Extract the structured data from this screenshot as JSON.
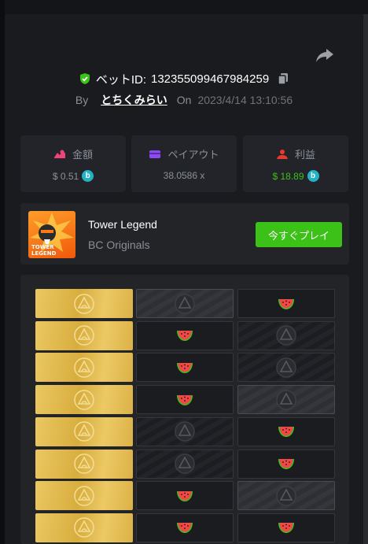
{
  "bet": {
    "id_label": "ベットID:",
    "id": "132355099467984259"
  },
  "meta": {
    "by": "By",
    "user": "とちくみらい",
    "on": "On",
    "date": "2023/4/14 13:10:56"
  },
  "stats": {
    "amount": {
      "label": "金額",
      "value": "$ 0.51",
      "icon": "money-icon"
    },
    "payout": {
      "label": "ペイアウト",
      "value": "38.0586 x",
      "icon": "card-icon"
    },
    "profit": {
      "label": "利益",
      "value": "$ 18.89",
      "icon": "profit-icon"
    }
  },
  "game": {
    "title": "Tower Legend",
    "provider": "BC Originals",
    "play_label": "今すぐプレイ",
    "thumb_text": "TOWER LEGEND"
  },
  "coin_symbol": "b",
  "colors": {
    "accent_green": "#3bc117",
    "gold": "#e3bd55",
    "coin": "#23b3c4"
  },
  "board": {
    "rows": [
      [
        "gold",
        "gray",
        "melon"
      ],
      [
        "gold",
        "melon",
        "dark-emblem"
      ],
      [
        "gold",
        "melon",
        "dark-emblem"
      ],
      [
        "gold",
        "melon",
        "gray"
      ],
      [
        "gold",
        "dark-emblem",
        "melon"
      ],
      [
        "gold",
        "dark-emblem",
        "melon"
      ],
      [
        "gold",
        "melon",
        "gray"
      ],
      [
        "gold",
        "melon",
        "melon"
      ]
    ]
  }
}
